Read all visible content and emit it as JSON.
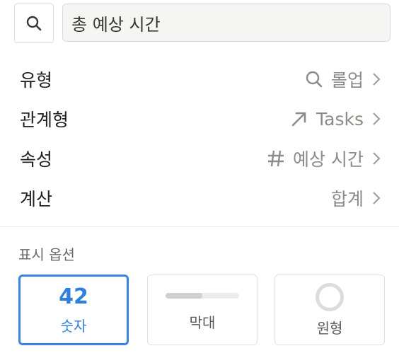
{
  "search": {
    "value": "총 예상 시간",
    "icon": "search-icon"
  },
  "rows": [
    {
      "label": "유형",
      "value": "롤업",
      "icon": "search-icon"
    },
    {
      "label": "관계형",
      "value": "Tasks",
      "icon": "arrow-up-right-icon"
    },
    {
      "label": "속성",
      "value": "예상 시간",
      "icon": "hash-icon"
    },
    {
      "label": "계산",
      "value": "합계",
      "icon": ""
    }
  ],
  "display": {
    "title": "표시 옵션",
    "options": [
      {
        "label": "숫자",
        "preview": "42",
        "selected": true
      },
      {
        "label": "막대",
        "selected": false,
        "bar_fill_fraction": 0.5
      },
      {
        "label": "원형",
        "selected": false
      }
    ]
  },
  "colors": {
    "accent": "#2f7fdc",
    "muted": "#8c8b87"
  }
}
